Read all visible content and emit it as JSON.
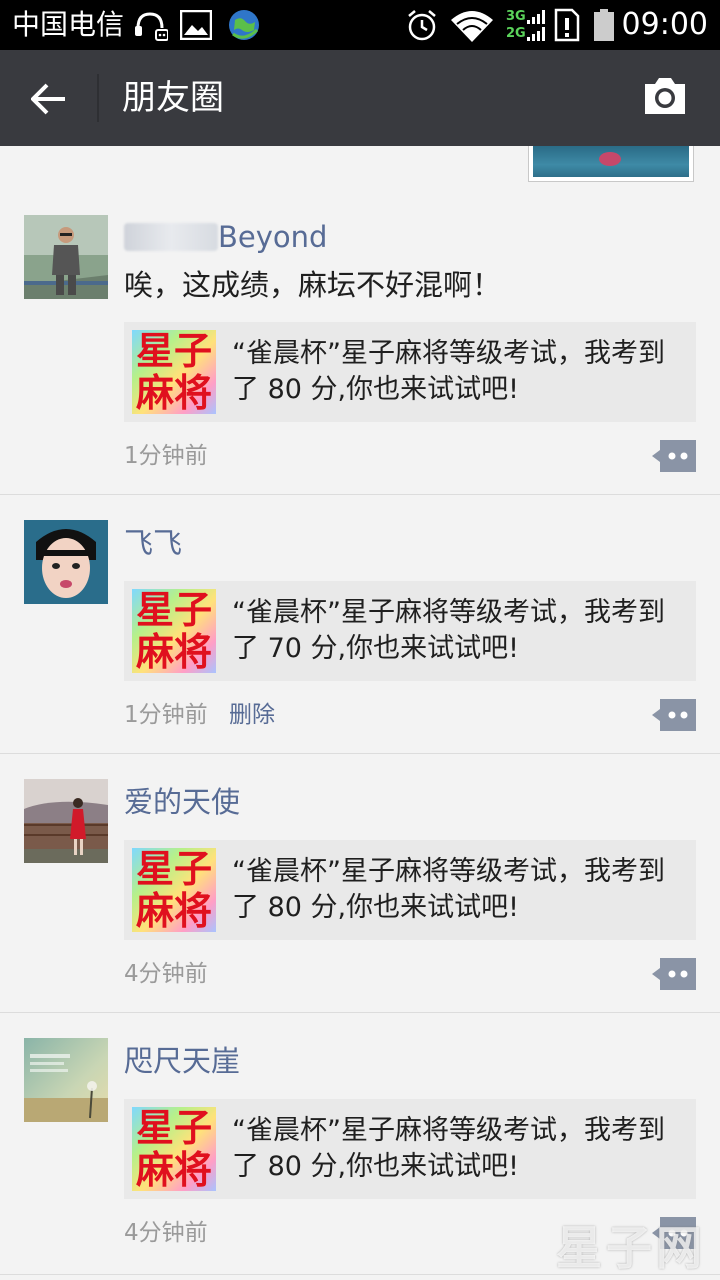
{
  "status_bar": {
    "carrier": "中国电信",
    "network_3g": "3G",
    "network_2g": "2G",
    "time": "09:00"
  },
  "header": {
    "title": "朋友圈",
    "back_icon": "arrow-left-icon",
    "camera_icon": "camera-icon"
  },
  "posts": [
    {
      "name_suffix": "Beyond",
      "text": "唉，这成绩，麻坛不好混啊！",
      "logo_line1": "星子",
      "logo_line2": "麻将",
      "share_text": "“雀晨杯”星子麻将等级考试，我考到了 80 分,你也来试试吧!",
      "time": "1分钟前"
    },
    {
      "name": "飞飞",
      "logo_line1": "星子",
      "logo_line2": "麻将",
      "share_text": "“雀晨杯”星子麻将等级考试，我考到了 70 分,你也来试试吧!",
      "time": "1分钟前",
      "delete_label": "删除"
    },
    {
      "name": "爱的天使",
      "logo_line1": "星子",
      "logo_line2": "麻将",
      "share_text": "“雀晨杯”星子麻将等级考试，我考到了 80 分,你也来试试吧!",
      "time": "4分钟前"
    },
    {
      "name": "咫尺天崖",
      "logo_line1": "星子",
      "logo_line2": "麻将",
      "share_text": "“雀晨杯”星子麻将等级考试，我考到了 80 分,你也来试试吧!",
      "time": "4分钟前"
    }
  ],
  "watermark": "星子网",
  "colors": {
    "status_bar": "#000000",
    "title_bar": "#393a3f",
    "feed_background": "#f3f3f3",
    "name_link": "#576b95",
    "share_card": "#e9e9e9",
    "comment_button": "#8a94a6"
  }
}
